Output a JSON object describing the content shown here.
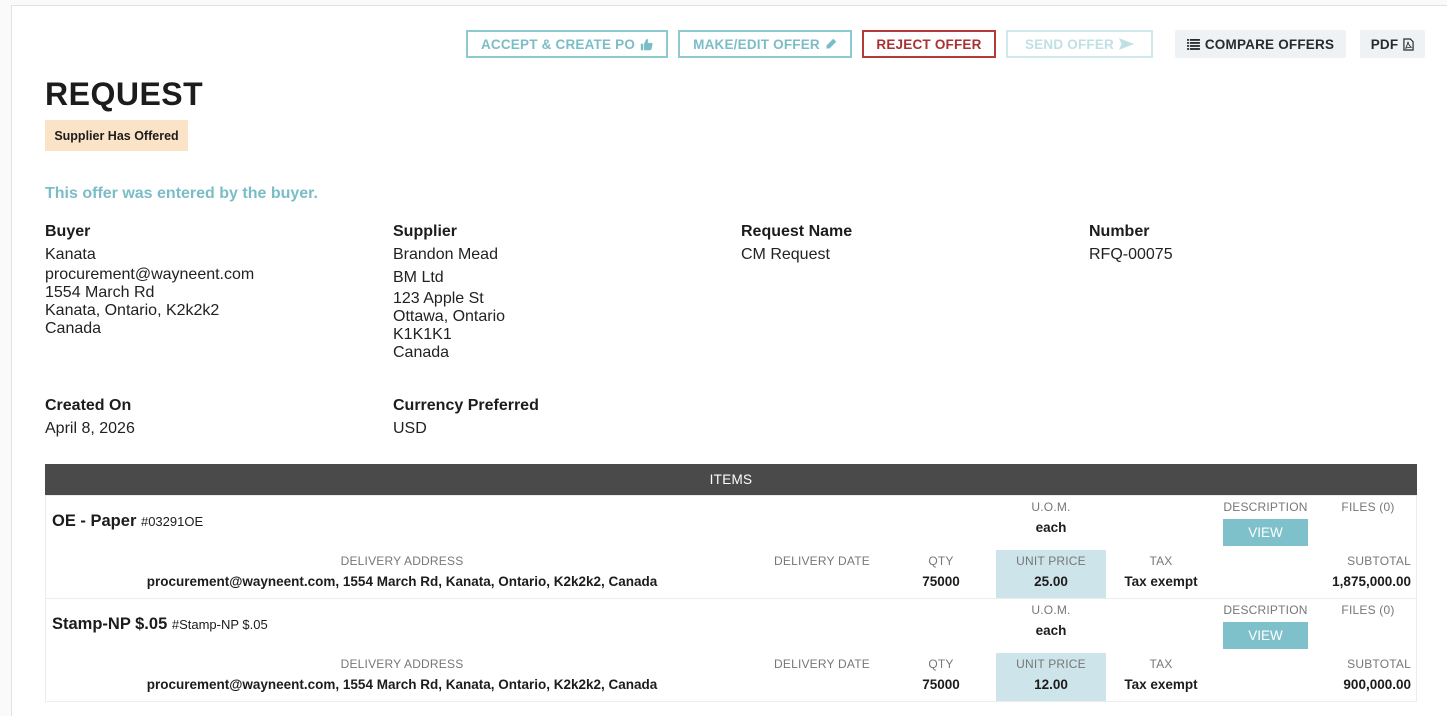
{
  "toolbar": {
    "accept_label": "ACCEPT & CREATE PO",
    "edit_label": "MAKE/EDIT OFFER",
    "reject_label": "REJECT OFFER",
    "send_label": "SEND OFFER",
    "compare_label": "COMPARE OFFERS",
    "pdf_label": "PDF"
  },
  "page": {
    "title": "REQUEST",
    "status": "Supplier Has Offered",
    "note": "This offer was entered by the buyer."
  },
  "buyer": {
    "label": "Buyer",
    "lines": [
      "Kanata",
      "procurement@wayneent.com",
      "1554 March Rd",
      "Kanata, Ontario, K2k2k2",
      "Canada"
    ]
  },
  "supplier": {
    "label": "Supplier",
    "lines": [
      "Brandon Mead",
      "BM Ltd",
      "123 Apple St",
      "Ottawa, Ontario",
      "K1K1K1",
      "Canada"
    ]
  },
  "request_name": {
    "label": "Request Name",
    "value": "CM Request"
  },
  "number": {
    "label": "Number",
    "value": "RFQ-00075"
  },
  "created_on": {
    "label": "Created On",
    "value": "April 8, 2026"
  },
  "currency": {
    "label": "Currency Preferred",
    "value": "USD"
  },
  "items_header": "ITEMS",
  "columns": {
    "uom": "U.O.M.",
    "description": "DESCRIPTION",
    "files": "FILES (0)",
    "delivery_address": "DELIVERY ADDRESS",
    "delivery_date": "DELIVERY DATE",
    "qty": "QTY",
    "unit_price": "UNIT PRICE",
    "tax": "TAX",
    "subtotal": "SUBTOTAL",
    "view_label": "VIEW"
  },
  "items": [
    {
      "name": "OE - Paper",
      "code": "#03291OE",
      "uom": "each",
      "delivery_address": "procurement@wayneent.com, 1554 March Rd, Kanata, Ontario, K2k2k2, Canada",
      "delivery_date": "",
      "qty": "75000",
      "unit_price": "25.00",
      "tax": "Tax exempt",
      "subtotal": "1,875,000.00"
    },
    {
      "name": "Stamp-NP $.05",
      "code": "#Stamp-NP $.05",
      "uom": "each",
      "delivery_address": "procurement@wayneent.com, 1554 March Rd, Kanata, Ontario, K2k2k2, Canada",
      "delivery_date": "",
      "qty": "75000",
      "unit_price": "12.00",
      "tax": "Tax exempt",
      "subtotal": "900,000.00"
    }
  ],
  "colors": {
    "teal": "#7bbdc7",
    "red": "#a83232",
    "badge": "#fbe3c7",
    "header": "#4a4a4a",
    "unit_price_bg": "#cde5ea"
  },
  "icons": {
    "accept": "thumbs-up-icon",
    "edit": "pencil-icon",
    "send": "send-icon",
    "compare": "list-icon",
    "pdf": "pdf-file-icon"
  }
}
